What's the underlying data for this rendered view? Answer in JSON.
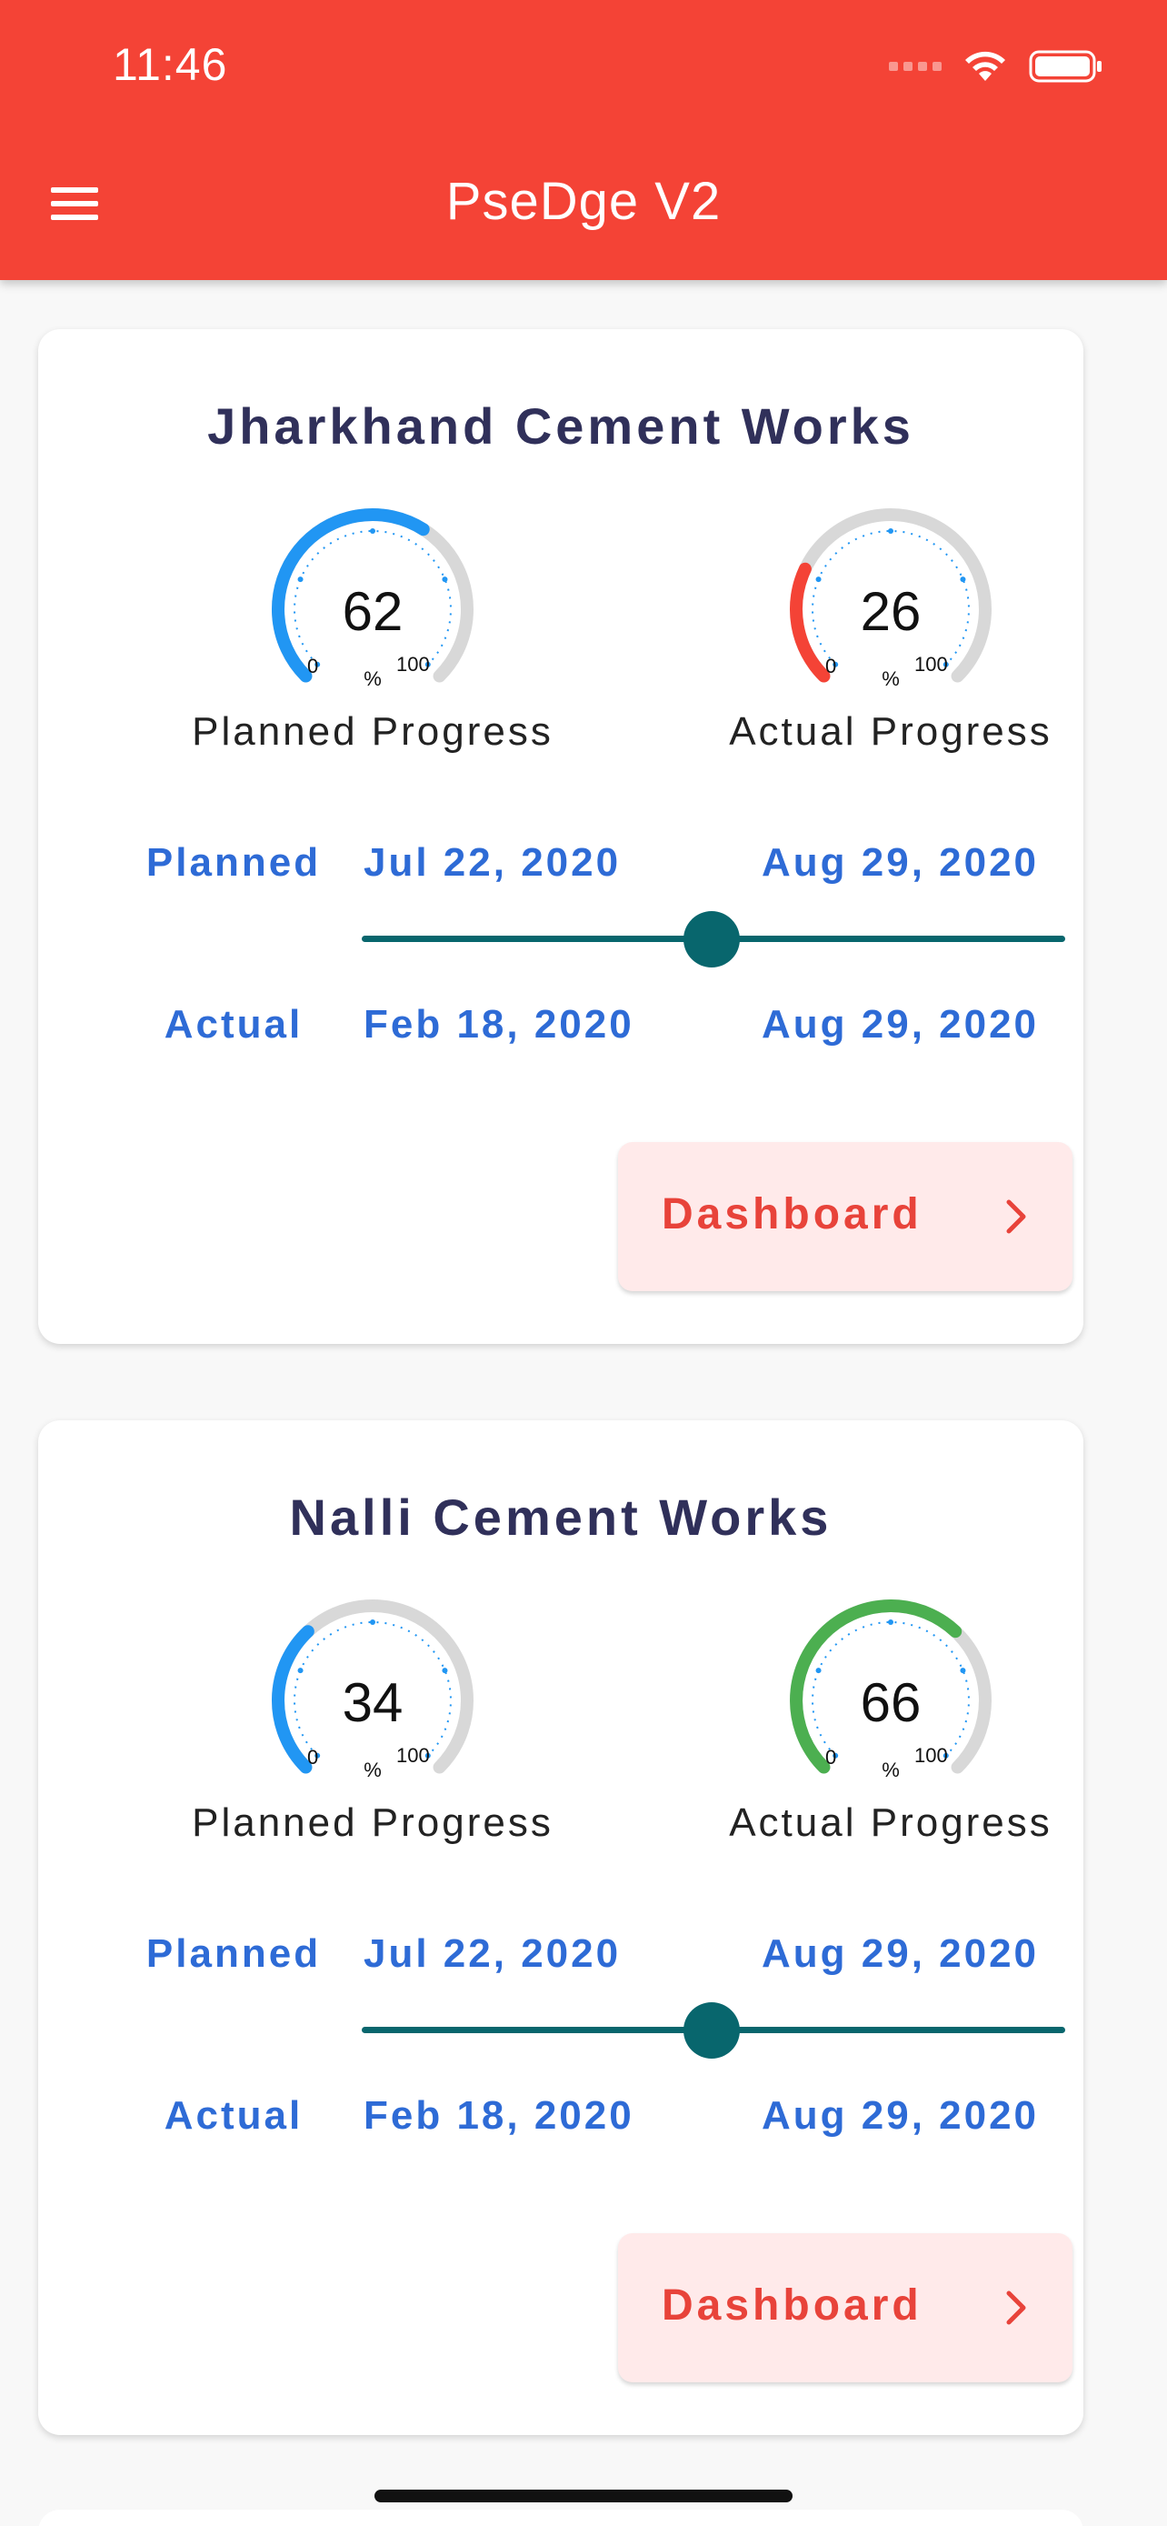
{
  "status_bar": {
    "time": "11:46"
  },
  "app_bar": {
    "title": "PseDge V2",
    "menu_icon": "hamburger-menu-icon",
    "color": "#f44336"
  },
  "projects": [
    {
      "name": "Jharkhand Cement Works",
      "planned_progress": {
        "value": "62",
        "label": "Planned Progress",
        "min": "0",
        "max": "100",
        "unit": "%",
        "percent": 62,
        "color": "#2196f3"
      },
      "actual_progress": {
        "value": "26",
        "label": "Actual Progress",
        "min": "0",
        "max": "100",
        "unit": "%",
        "percent": 26,
        "color": "#f44336"
      },
      "planned_label": "Planned",
      "planned_start": "Jul 22, 2020",
      "planned_end": "Aug 29, 2020",
      "actual_label": "Actual",
      "actual_start": "Feb 18, 2020",
      "actual_end": "Aug 29, 2020",
      "button_label": "Dashboard"
    },
    {
      "name": "Nalli Cement Works",
      "planned_progress": {
        "value": "34",
        "label": "Planned Progress",
        "min": "0",
        "max": "100",
        "unit": "%",
        "percent": 34,
        "color": "#2196f3"
      },
      "actual_progress": {
        "value": "66",
        "label": "Actual Progress",
        "min": "0",
        "max": "100",
        "unit": "%",
        "percent": 66,
        "color": "#4caf50"
      },
      "planned_label": "Planned",
      "planned_start": "Jul 22, 2020",
      "planned_end": "Aug 29, 2020",
      "actual_label": "Actual",
      "actual_start": "Feb 18, 2020",
      "actual_end": "Aug 29, 2020",
      "button_label": "Dashboard"
    }
  ],
  "colors": {
    "date_text": "#2e6bd6",
    "slider": "#08666d",
    "dashboard_bg": "#ffeaea",
    "dashboard_text": "#e8433a",
    "gauge_track": "#d8d8d8"
  }
}
